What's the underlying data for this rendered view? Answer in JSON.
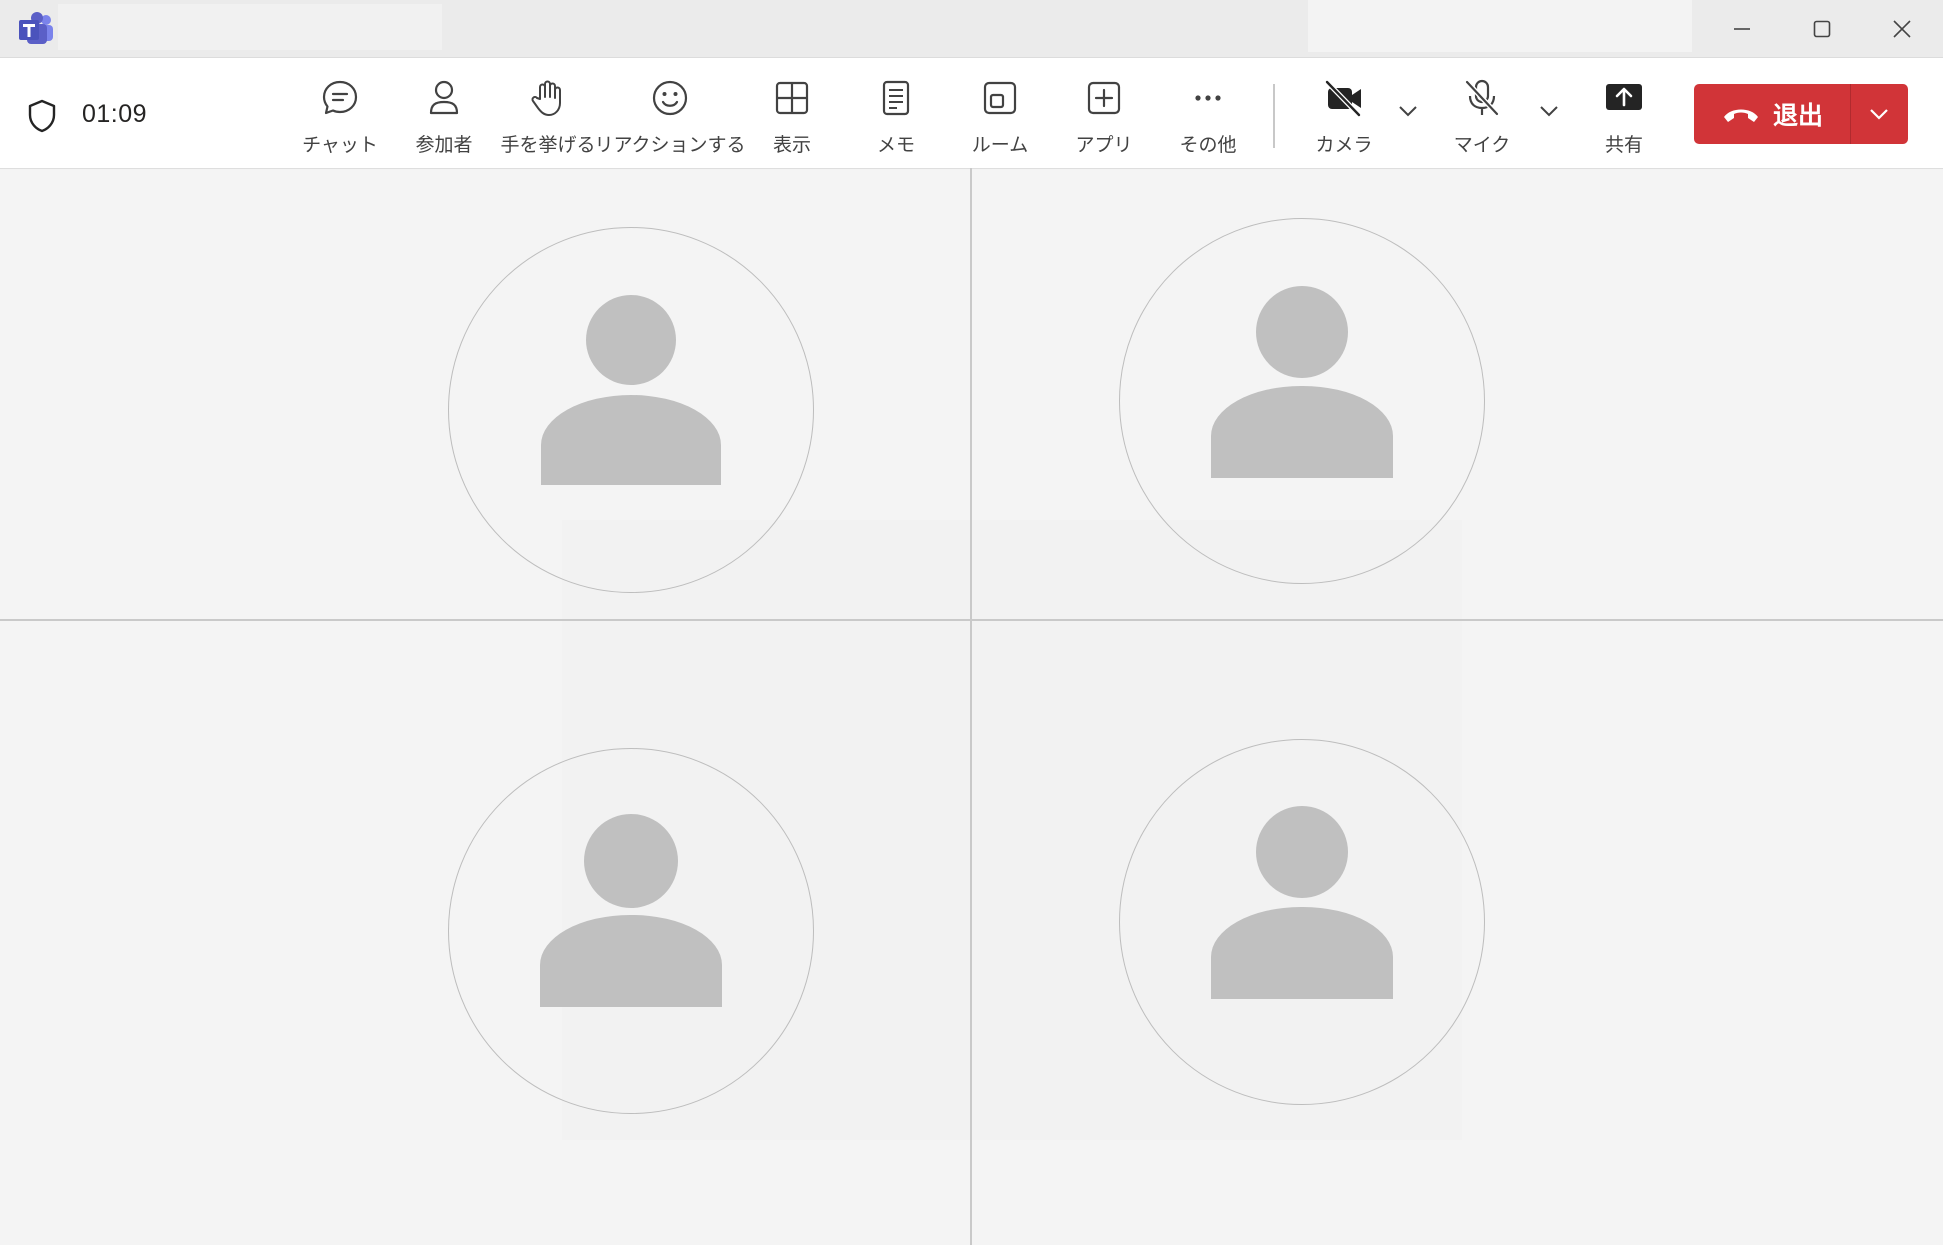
{
  "titlebar": {
    "app_icon": "teams-logo-icon",
    "window_controls": [
      "minimize-icon",
      "maximize-icon",
      "close-icon"
    ]
  },
  "meeting": {
    "timer": "01:09"
  },
  "toolbar": {
    "chat": "チャット",
    "participants": "参加者",
    "raise_hand": "手を挙げる",
    "react": "リアクションする",
    "view": "表示",
    "notes": "メモ",
    "rooms": "ルーム",
    "apps": "アプリ",
    "more": "その他",
    "camera": "カメラ",
    "mic": "マイク",
    "share": "共有",
    "leave": "退出"
  },
  "participants": [
    {
      "avatar": "person-placeholder-icon"
    },
    {
      "avatar": "person-placeholder-icon"
    },
    {
      "avatar": "person-placeholder-icon"
    },
    {
      "avatar": "person-placeholder-icon"
    }
  ],
  "colors": {
    "leave_red": "#d13438",
    "toolbar_bg": "#ffffff",
    "stage_bg": "#f4f4f4",
    "avatar_gray": "#c0c0c0",
    "teams_purple": "#5b5fc7"
  }
}
